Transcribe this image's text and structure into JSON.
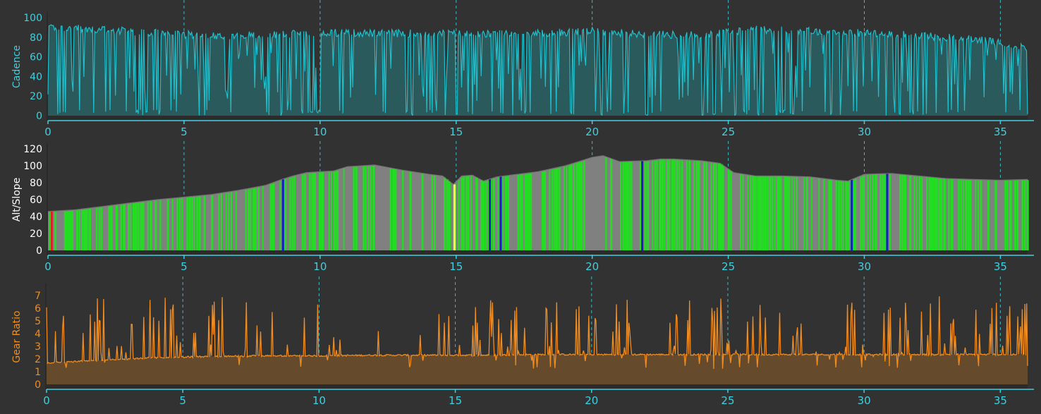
{
  "colors": {
    "background": "#323232",
    "x_axis": "#3fd0e0",
    "grid": "#3fd0e0",
    "cadence_line": "#1fbfcc",
    "cadence_fill": "#2a5a5c",
    "alt_fill": "#808080",
    "slope_green": "#22dd22",
    "slope_blue": "#1020c0",
    "slope_yellow": "#ffff33",
    "slope_red": "#dd2222",
    "gear_line": "#f08c20",
    "gear_fill": "#664a2c",
    "alt_label": "#ffffff"
  },
  "chart_data": [
    {
      "type": "area",
      "name": "cadence",
      "ylabel": "Cadence",
      "xlim": [
        0,
        36
      ],
      "ylim": [
        0,
        100
      ],
      "yticks": [
        0,
        20,
        40,
        60,
        80,
        100
      ],
      "xticks": [
        0,
        5,
        10,
        15,
        20,
        25,
        30,
        35
      ],
      "grid": true,
      "baseline_envelope": {
        "x": [
          0,
          2,
          4,
          6,
          8,
          10,
          12,
          14,
          16,
          18,
          20,
          22,
          24,
          26,
          28,
          30,
          32,
          34,
          36
        ],
        "y": [
          90,
          88,
          84,
          82,
          82,
          85,
          84,
          84,
          83,
          84,
          86,
          83,
          82,
          88,
          86,
          84,
          82,
          78,
          70
        ]
      },
      "drop_minimum": 0
    },
    {
      "type": "area",
      "name": "altitude_slope",
      "ylabel": "Alt/Slope",
      "xlim": [
        0,
        36
      ],
      "ylim": [
        0,
        120
      ],
      "yticks": [
        0,
        20,
        40,
        60,
        80,
        100,
        120
      ],
      "xticks": [
        0,
        5,
        10,
        15,
        20,
        25,
        30,
        35
      ],
      "grid": true,
      "altitude": {
        "x": [
          0,
          1,
          2,
          3,
          4,
          5,
          6,
          7,
          8,
          8.6,
          9,
          9.5,
          10,
          10.5,
          11,
          12,
          13,
          14,
          14.5,
          14.9,
          15.2,
          15.6,
          16,
          16.5,
          17,
          18,
          19,
          20,
          20.4,
          21,
          22,
          22.5,
          23,
          24,
          24.7,
          25.2,
          26,
          27,
          28,
          29,
          29.4,
          30,
          31,
          32,
          33,
          34,
          35,
          36
        ],
        "y": [
          46,
          48,
          52,
          56,
          60,
          63,
          66,
          71,
          77,
          84,
          88,
          92,
          93,
          94,
          99,
          101,
          95,
          90,
          88,
          78,
          88,
          89,
          82,
          87,
          89,
          93,
          100,
          110,
          112,
          105,
          106,
          108,
          108,
          106,
          103,
          92,
          88,
          88,
          87,
          83,
          82,
          90,
          91,
          88,
          85,
          84,
          83,
          84
        ]
      },
      "slope_markers": [
        {
          "x": 0.1,
          "color": "slope_red"
        },
        {
          "x": 8.6,
          "color": "slope_blue"
        },
        {
          "x": 14.9,
          "color": "slope_yellow"
        },
        {
          "x": 16.2,
          "color": "slope_blue"
        },
        {
          "x": 16.6,
          "color": "slope_blue"
        },
        {
          "x": 21.8,
          "color": "slope_blue"
        },
        {
          "x": 29.5,
          "color": "slope_blue"
        },
        {
          "x": 30.8,
          "color": "slope_blue"
        }
      ]
    },
    {
      "type": "area",
      "name": "gear_ratio",
      "ylabel": "Gear Ratio",
      "xlim": [
        0,
        36
      ],
      "ylim": [
        0,
        7.5
      ],
      "yticks": [
        0,
        1,
        2,
        3,
        4,
        5,
        6,
        7
      ],
      "xticks": [
        0,
        5,
        10,
        15,
        20,
        25,
        30,
        35
      ],
      "grid": true,
      "baseline": {
        "x": [
          0,
          1,
          2,
          3,
          4,
          5,
          6,
          8,
          10,
          12,
          14,
          16,
          18,
          20,
          22,
          24,
          26,
          28,
          30,
          32,
          34,
          36
        ],
        "y": [
          1.7,
          1.8,
          1.9,
          2.0,
          2.1,
          2.15,
          2.2,
          2.25,
          2.25,
          2.3,
          2.3,
          2.3,
          2.35,
          2.35,
          2.35,
          2.35,
          2.35,
          2.35,
          2.35,
          2.35,
          2.35,
          2.35
        ]
      },
      "spike_max": 7
    }
  ]
}
